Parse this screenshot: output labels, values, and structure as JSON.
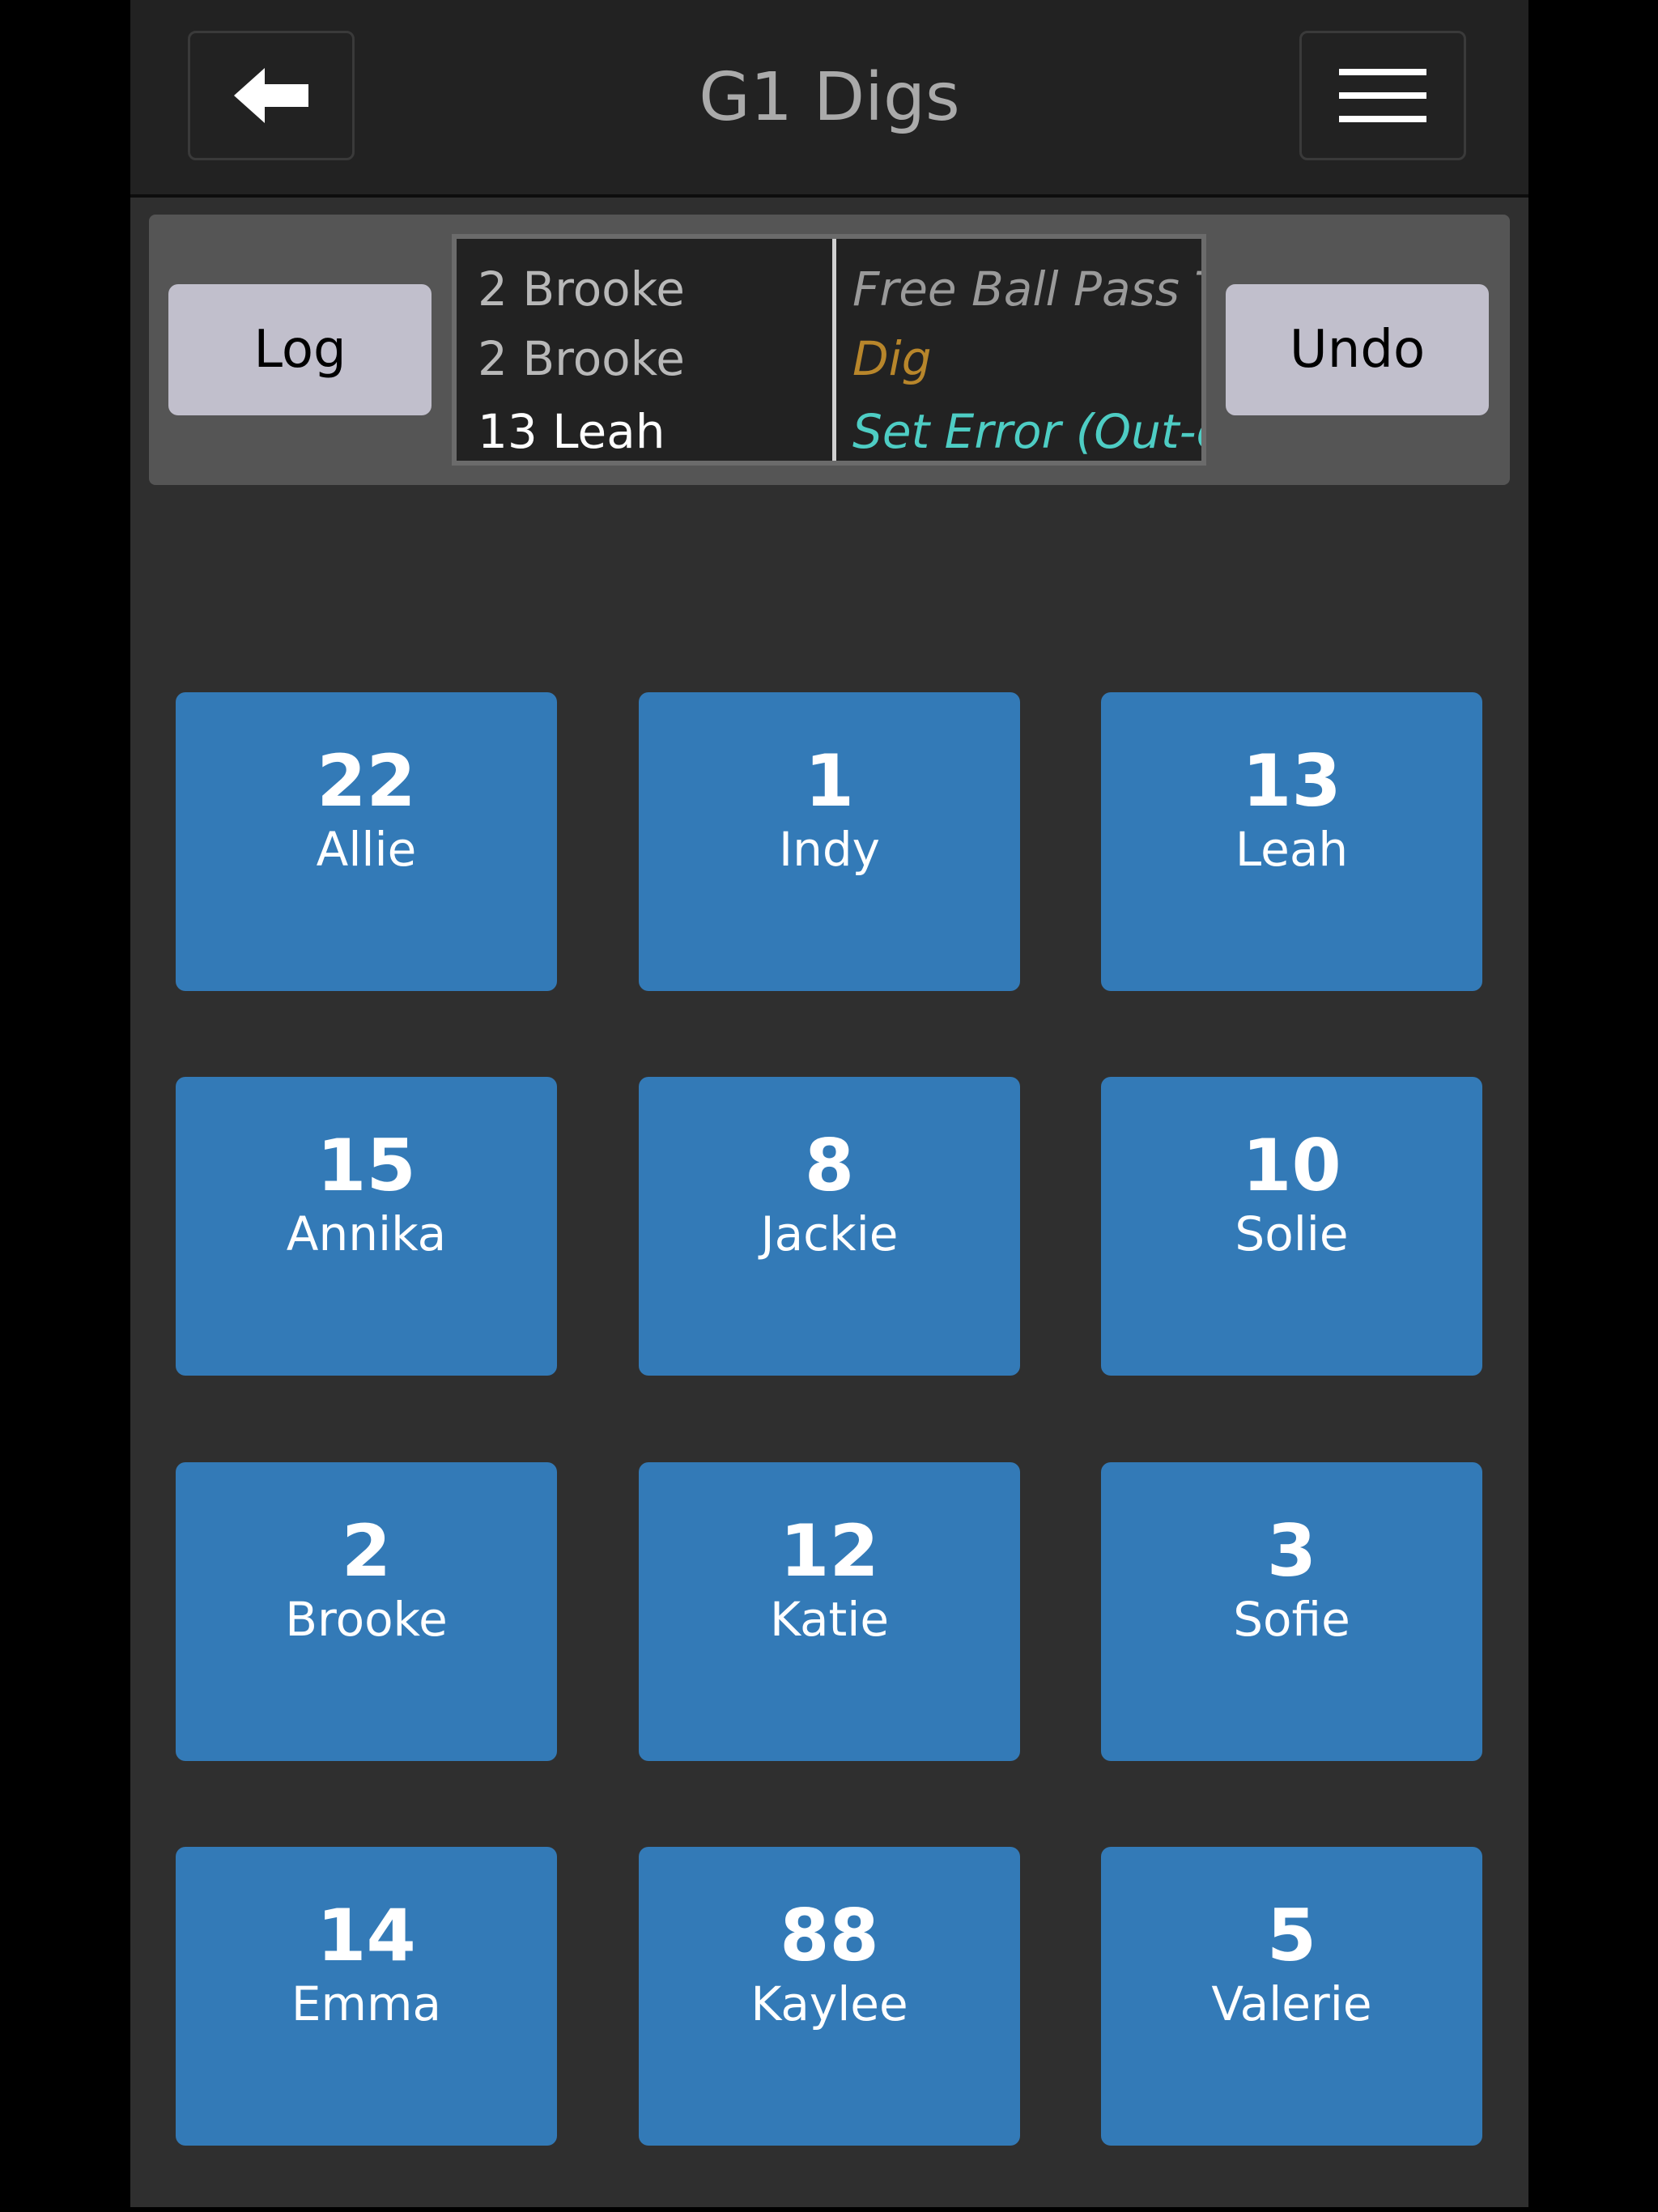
{
  "header": {
    "title": "G1 Digs"
  },
  "log": {
    "log_label": "Log",
    "undo_label": "Undo",
    "players": [
      "2 Brooke",
      "2 Brooke",
      "13 Leah"
    ],
    "actions": [
      "Free Ball Pass To",
      "Dig",
      "Set Error (Out-of"
    ],
    "colors": {
      "player_old": "#b8b8b8",
      "player_current": "#ffffff",
      "action_1": "#8a8a8a",
      "action_2": "#b8862b",
      "action_3": "#4ecdc4"
    }
  },
  "roster": [
    {
      "number": "22",
      "name": "Allie"
    },
    {
      "number": "1",
      "name": "Indy"
    },
    {
      "number": "13",
      "name": "Leah"
    },
    {
      "number": "15",
      "name": "Annika"
    },
    {
      "number": "8",
      "name": "Jackie"
    },
    {
      "number": "10",
      "name": "Solie"
    },
    {
      "number": "2",
      "name": "Brooke"
    },
    {
      "number": "12",
      "name": "Katie"
    },
    {
      "number": "3",
      "name": "Sofie"
    },
    {
      "number": "14",
      "name": "Emma"
    },
    {
      "number": "88",
      "name": "Kaylee"
    },
    {
      "number": "5",
      "name": "Valerie"
    }
  ],
  "icons": {
    "back": "arrow-left-icon",
    "menu": "hamburger-menu-icon"
  }
}
